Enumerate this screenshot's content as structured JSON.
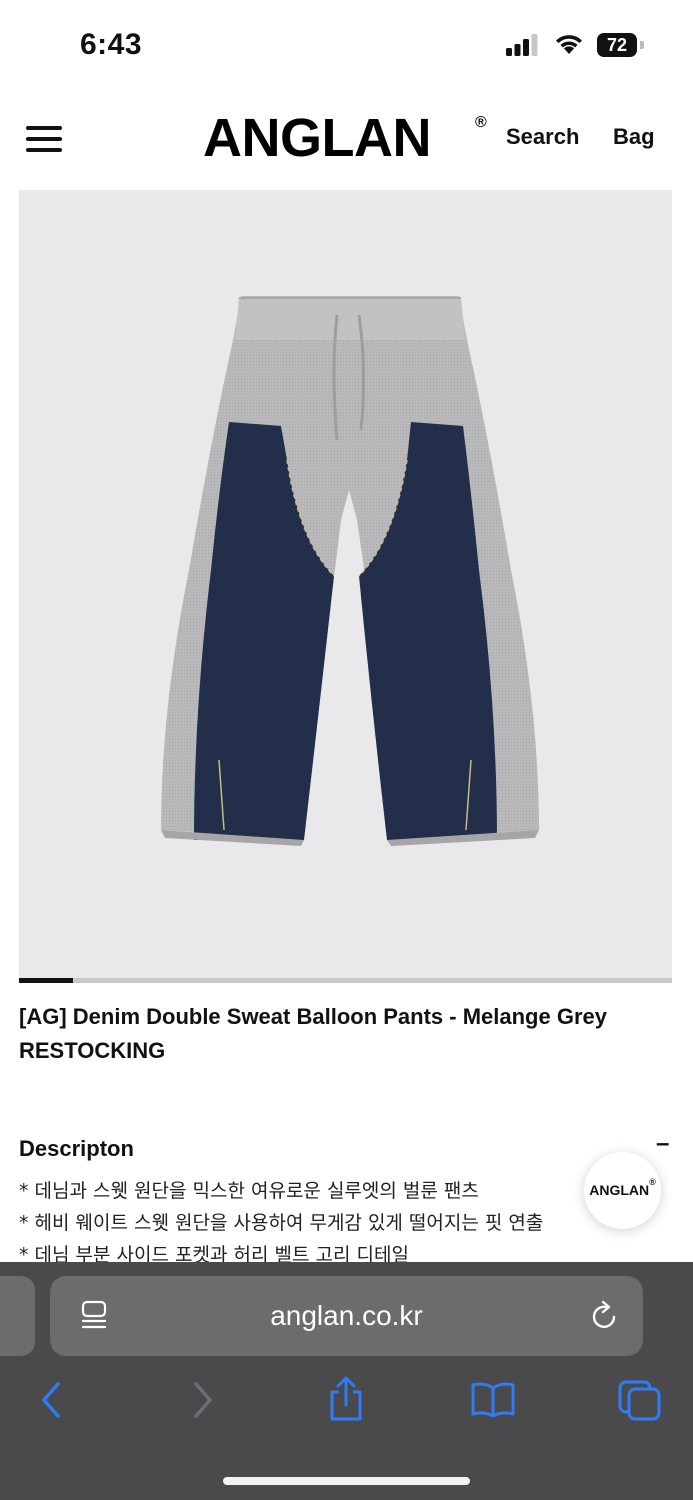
{
  "status_bar": {
    "time": "6:43",
    "battery": "72"
  },
  "header": {
    "logo": "ANGLAN",
    "logo_mark": "®",
    "search": "Search",
    "bag": "Bag"
  },
  "product": {
    "title": "[AG] Denim Double Sweat Balloon Pants - Melange Grey",
    "status": "RESTOCKING",
    "image_position": 0.08
  },
  "description": {
    "heading": "Descripton",
    "toggle": "–",
    "lines": [
      "* 데님과 스웻 원단을 믹스한 여유로운 실루엣의 벌룬 팬츠",
      "* 헤비 웨이트 스웻 원단을 사용하여 무게감 있게 떨어지는 핏 연출",
      "* 데님 부분 사이드 포켓과 허리 벨트 고리 디테일"
    ]
  },
  "fab": {
    "label": "ANGLAN",
    "mark": "®"
  },
  "browser": {
    "url": "anglan.co.kr"
  },
  "colors": {
    "accent": "#2f7cf6",
    "toolbar": "#4a4a4c",
    "urlbar": "#6c6c6e",
    "image_bg": "#e9e9eb"
  }
}
